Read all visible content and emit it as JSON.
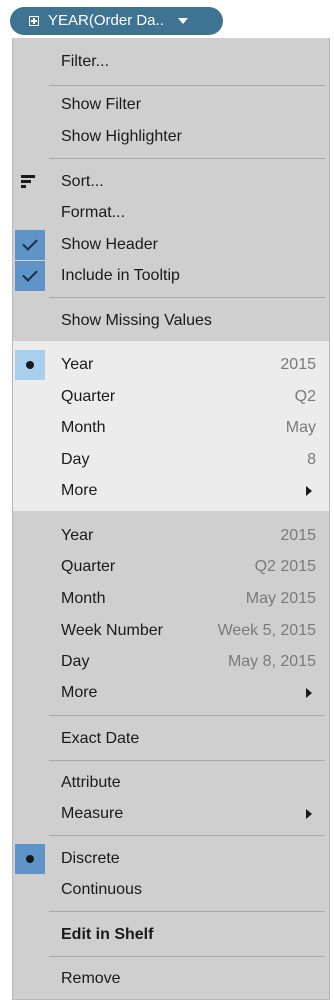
{
  "pill": {
    "label": "YEAR(Order Da..",
    "expand_icon": "plus-box-icon",
    "caret_icon": "caret-down-icon"
  },
  "menu": {
    "filter": "Filter...",
    "show_filter": "Show Filter",
    "show_highlighter": "Show Highlighter",
    "sort": "Sort...",
    "sort_icon": "sort-icon",
    "format": "Format...",
    "show_header": "Show Header",
    "include_tooltip": "Include in Tooltip",
    "show_missing": "Show Missing Values",
    "date_parts": [
      {
        "label": "Year",
        "value": "2015",
        "selected": true
      },
      {
        "label": "Quarter",
        "value": "Q2"
      },
      {
        "label": "Month",
        "value": "May"
      },
      {
        "label": "Day",
        "value": "8"
      },
      {
        "label": "More",
        "submenu": true
      }
    ],
    "date_values": [
      {
        "label": "Year",
        "value": "2015"
      },
      {
        "label": "Quarter",
        "value": "Q2 2015"
      },
      {
        "label": "Month",
        "value": "May 2015"
      },
      {
        "label": "Week Number",
        "value": "Week 5, 2015"
      },
      {
        "label": "Day",
        "value": "May 8, 2015"
      },
      {
        "label": "More",
        "submenu": true
      }
    ],
    "exact_date": "Exact Date",
    "attribute": "Attribute",
    "measure": "Measure",
    "discrete": "Discrete",
    "continuous": "Continuous",
    "edit_in_shelf": "Edit in Shelf",
    "remove": "Remove"
  },
  "colors": {
    "pill": "#3f7392",
    "menu_bg": "#cfcfcf",
    "highlight_section": "#ececec",
    "checked": "#5f94c8",
    "selected": "#a9cfef"
  }
}
